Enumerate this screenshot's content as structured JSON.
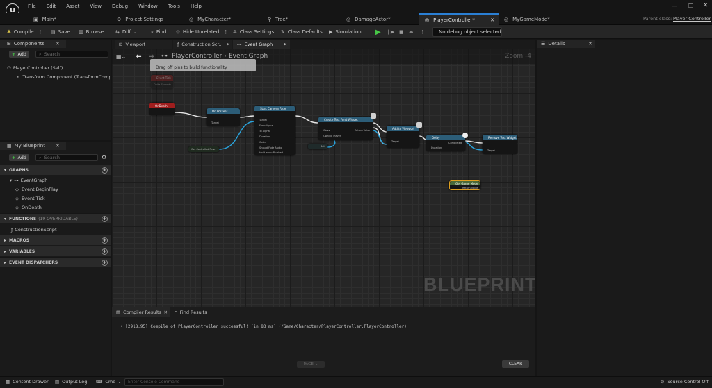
{
  "menu": [
    "File",
    "Edit",
    "Asset",
    "View",
    "Debug",
    "Window",
    "Tools",
    "Help"
  ],
  "tabs": [
    {
      "label": "Main*",
      "icon": "▣"
    },
    {
      "label": "Project Settings",
      "icon": "⚙"
    },
    {
      "label": "MyCharacter*",
      "icon": "◎"
    },
    {
      "label": "Tree*",
      "icon": "⚲"
    },
    {
      "label": "DamageActor*",
      "icon": "◎"
    },
    {
      "label": "PlayerController*",
      "icon": "◎"
    },
    {
      "label": "MyGameMode*",
      "icon": "◎"
    }
  ],
  "parent_class_label": "Parent class:",
  "parent_class_value": "Player Controller",
  "toolbar": {
    "compile": "Compile",
    "save": "Save",
    "browse": "Browse",
    "diff": "Diff",
    "find": "Find",
    "hide_unrelated": "Hide Unrelated",
    "class_settings": "Class Settings",
    "class_defaults": "Class Defaults",
    "simulation": "Simulation",
    "debug_object": "No debug object selected"
  },
  "components": {
    "tab": "Components",
    "add": "Add",
    "search_placeholder": "Search",
    "items": [
      "PlayerController (Self)",
      "Transform Component (TransformComp"
    ]
  },
  "my_blueprint": {
    "tab": "My Blueprint",
    "add": "Add",
    "search_placeholder": "Search",
    "graphs_header": "GRAPHS",
    "event_graph": "EventGraph",
    "events": [
      "Event BeginPlay",
      "Event Tick",
      "OnDeath"
    ],
    "functions_header": "FUNCTIONS",
    "functions_note": "(19 OVERRIDABLE)",
    "construction_script": "ConstructionScript",
    "macros": "MACROS",
    "variables": "VARIABLES",
    "dispatchers": "EVENT DISPATCHERS"
  },
  "graph_tabs": {
    "viewport": "Viewport",
    "construction": "Construction Scr...",
    "event_graph": "Event Graph"
  },
  "graph": {
    "breadcrumb_root": "PlayerController",
    "breadcrumb_leaf": "Event Graph",
    "zoom": "Zoom -4",
    "tooltip": "Drag off pins to build functionality.",
    "watermark": "BLUEPRINT"
  },
  "nodes": {
    "event_tick": "Event Tick",
    "ondeath": "OnDeath",
    "on_possess": "On Possess",
    "start_camera_fade": "Start Camera Fade",
    "create_widget": "Create Test Fond Widget",
    "add_to_viewport": "Add to Viewport",
    "delay": "Delay",
    "remove": "Remove Test Widget",
    "get_game_mode": "Get Game Mode",
    "get_controlled_pawn": "Get Controlled Pawn",
    "self": "Self",
    "pin_target": "Target",
    "pin_from_alpha": "From Alpha",
    "pin_to_alpha": "To Alpha",
    "pin_duration": "Duration",
    "pin_color": "Color",
    "pin_should_fade_audio": "Should Fade Audio",
    "pin_hold_when_finished": "Hold when Finished",
    "pin_class": "Class",
    "pin_owning_player": "Owning Player",
    "pin_return_value": "Return Value",
    "pin_completed": "Completed",
    "pin_delta_seconds": "Delta Seconds"
  },
  "details": {
    "tab": "Details"
  },
  "bottom_tabs": {
    "compiler_results": "Compiler Results",
    "find_results": "Find Results"
  },
  "log_line": "[2918.95] Compile of PlayerController successful! [in 83 ms] (/Game/Character/PlayerController.PlayerController)",
  "page_btn": "PAGE",
  "clear_btn": "CLEAR",
  "statusbar": {
    "content_drawer": "Content Drawer",
    "output_log": "Output Log",
    "cmd": "Cmd",
    "console_placeholder": "Enter Console Command",
    "source_control": "Source Control Off"
  },
  "colors": {
    "accent": "#2a7fd4",
    "event_red": "#8a1a1a",
    "function_blue": "#2c5d78",
    "pure_green": "#4a6a3a",
    "green_play": "#47c847"
  }
}
